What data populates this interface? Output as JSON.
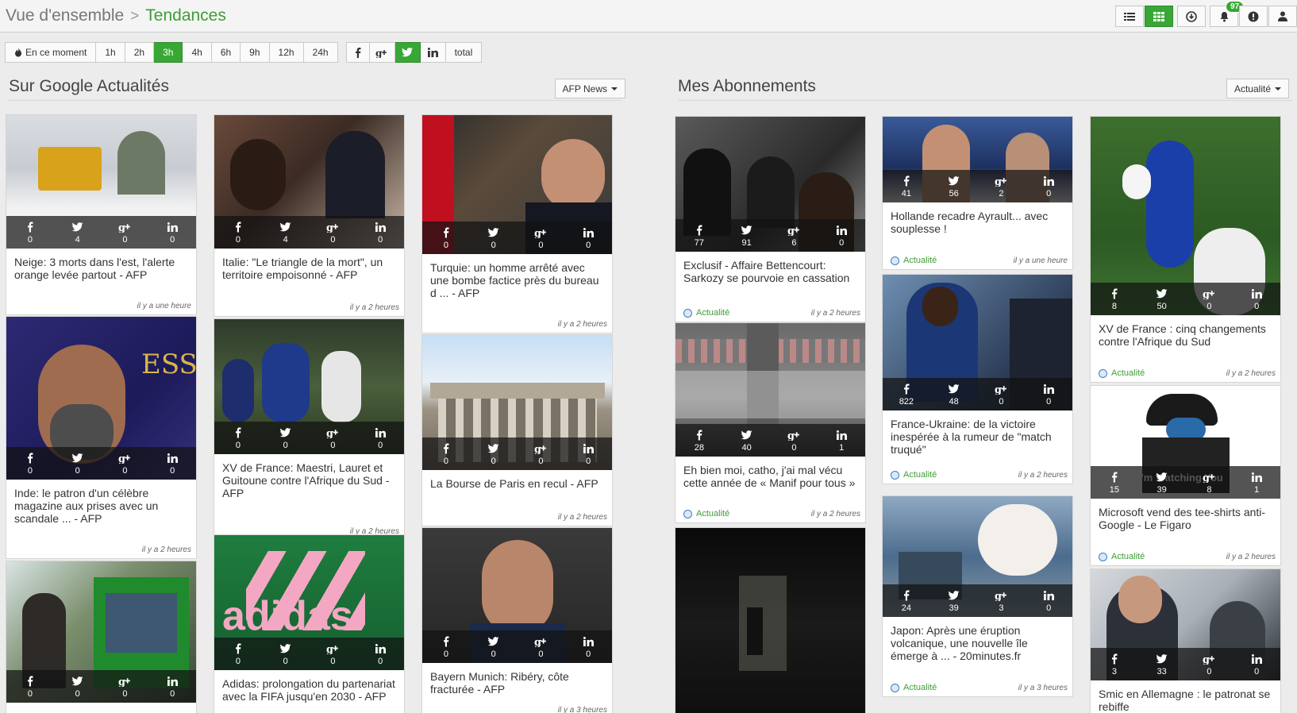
{
  "breadcrumb": {
    "parent": "Vue d'ensemble",
    "separator": ">",
    "current": "Tendances"
  },
  "toolbar": {
    "notifications_count": "97",
    "buttons": [
      "list-view",
      "grid-view",
      "download",
      "notifications",
      "alert",
      "user"
    ]
  },
  "time_filters": {
    "now_label": "En ce moment",
    "options": [
      "1h",
      "2h",
      "3h",
      "4h",
      "6h",
      "9h",
      "12h",
      "24h"
    ],
    "selected": "3h"
  },
  "network_filters": {
    "options": [
      "facebook",
      "google-plus",
      "twitter",
      "linkedin"
    ],
    "total_label": "total",
    "selected": "twitter"
  },
  "colors": {
    "accent": "#38a735",
    "link": "#3e9e36"
  },
  "left_section": {
    "title": "Sur Google Actualités",
    "dropdown": "AFP News"
  },
  "right_section": {
    "title": "Mes Abonnements",
    "dropdown": "Actualité"
  },
  "cards": [
    {
      "title": "Neige: 3 morts dans l'est, l'alerte orange levée partout - AFP",
      "time": "il y a une heure",
      "source": "",
      "fb": "0",
      "tw": "4",
      "gp": "0",
      "li": "0"
    },
    {
      "title": "Italie: \"Le triangle de la mort\", un territoire empoisonné - AFP",
      "time": "il y a 2 heures",
      "source": "",
      "fb": "0",
      "tw": "4",
      "gp": "0",
      "li": "0"
    },
    {
      "title": "Turquie: un homme arrêté avec une bombe factice près du bureau d ... - AFP",
      "time": "il y a 2 heures",
      "source": "",
      "fb": "0",
      "tw": "0",
      "gp": "0",
      "li": "0"
    },
    {
      "title": "Inde: le patron d'un célèbre magazine aux prises avec un scandale ... - AFP",
      "time": "il y a 2 heures",
      "source": "",
      "fb": "0",
      "tw": "0",
      "gp": "0",
      "li": "0"
    },
    {
      "title": "XV de France: Maestri, Lauret et Guitoune contre l'Afrique du Sud - AFP",
      "time": "il y a 2 heures",
      "source": "",
      "fb": "0",
      "tw": "0",
      "gp": "0",
      "li": "0"
    },
    {
      "title": "La Bourse de Paris en recul - AFP",
      "time": "il y a 2 heures",
      "source": "",
      "fb": "0",
      "tw": "0",
      "gp": "0",
      "li": "0"
    },
    {
      "title": "",
      "time": "",
      "source": "",
      "fb": "0",
      "tw": "0",
      "gp": "0",
      "li": "0"
    },
    {
      "title": "Adidas: prolongation du partenariat avec la FIFA jusqu'en 2030 - AFP",
      "time": "",
      "source": "",
      "fb": "0",
      "tw": "0",
      "gp": "0",
      "li": "0"
    },
    {
      "title": "Bayern Munich: Ribéry, côte fracturée - AFP",
      "time": "il y a 3 heures",
      "source": "",
      "fb": "0",
      "tw": "0",
      "gp": "0",
      "li": "0"
    },
    {
      "title": "Exclusif - Affaire Bettencourt: Sarkozy se pourvoie en cassation",
      "time": "il y a 2 heures",
      "source": "Actualité",
      "fb": "77",
      "tw": "91",
      "gp": "6",
      "li": "0"
    },
    {
      "title": "Hollande recadre Ayrault... avec souplesse !",
      "time": "il y a une heure",
      "source": "Actualité",
      "fb": "41",
      "tw": "56",
      "gp": "2",
      "li": "0"
    },
    {
      "title": "XV de France : cinq changements contre l'Afrique du Sud",
      "time": "il y a 2 heures",
      "source": "Actualité",
      "fb": "8",
      "tw": "50",
      "gp": "0",
      "li": "0"
    },
    {
      "title": "Eh bien moi, catho, j'ai mal vécu cette année de « Manif pour tous »",
      "time": "il y a 2 heures",
      "source": "Actualité",
      "fb": "28",
      "tw": "40",
      "gp": "0",
      "li": "1"
    },
    {
      "title": "France-Ukraine: de la victoire inespérée à la rumeur de \"match truqué\"",
      "time": "il y a 2 heures",
      "source": "Actualité",
      "fb": "822",
      "tw": "48",
      "gp": "0",
      "li": "0"
    },
    {
      "title": "Microsoft vend des tee-shirts anti-Google - Le Figaro",
      "time": "il y a 2 heures",
      "source": "Actualité",
      "fb": "15",
      "tw": "39",
      "gp": "8",
      "li": "1"
    },
    {
      "title": "",
      "time": "",
      "source": "",
      "fb": "",
      "tw": "",
      "gp": "",
      "li": ""
    },
    {
      "title": "Japon: Après une éruption volcanique, une nouvelle île émerge à ... - 20minutes.fr",
      "time": "il y a 3 heures",
      "source": "Actualité",
      "fb": "24",
      "tw": "39",
      "gp": "3",
      "li": "0"
    },
    {
      "title": "Smic en Allemagne : le patronat se rebiffe",
      "time": "",
      "source": "",
      "fb": "3",
      "tw": "33",
      "gp": "0",
      "li": "0"
    }
  ]
}
